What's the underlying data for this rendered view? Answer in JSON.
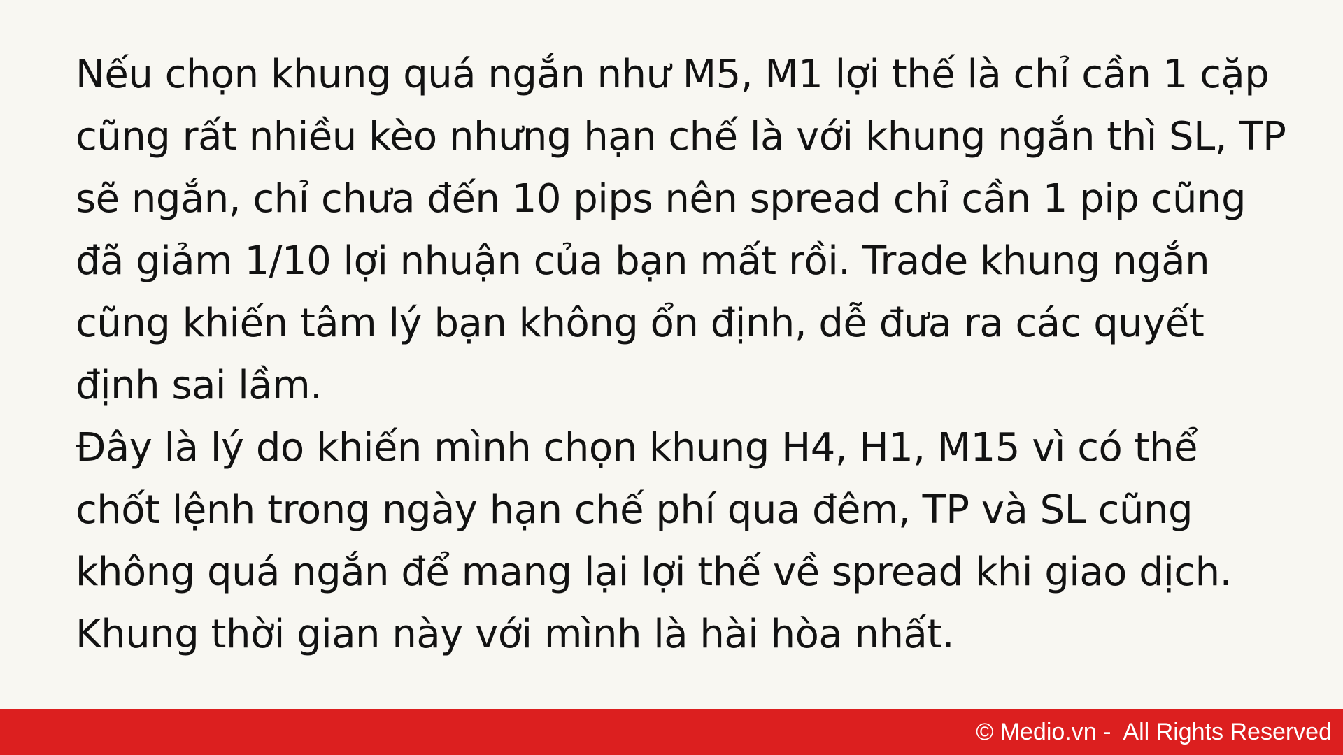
{
  "content": {
    "paragraph_1": "Nếu chọn khung quá ngắn như M5, M1 lợi thế là chỉ cần 1 cặp cũng rất nhiều kèo nhưng hạn chế là với khung ngắn thì SL, TP sẽ ngắn, chỉ chưa đến 10 pips nên spread chỉ cần 1 pip cũng đã giảm 1/10 lợi nhuận của bạn mất rồi. Trade khung ngắn cũng khiến tâm lý bạn không ổn định, dễ đưa ra các quyết định sai lầm.",
    "paragraph_2": "Đây là lý do khiến mình chọn khung H4, H1, M15 vì có thể chốt lệnh trong ngày hạn chế phí qua đêm, TP và SL cũng không quá ngắn để mang lại lợi thế về spread khi giao dịch. Khung thời gian này với mình là hài hòa nhất."
  },
  "footer": {
    "copyright": "© Medio.vn -  All Rights Reserved"
  },
  "colors": {
    "background": "#f8f7f2",
    "text": "#121212",
    "footer_bar": "#dc1f1f",
    "footer_text": "#ffffff"
  }
}
